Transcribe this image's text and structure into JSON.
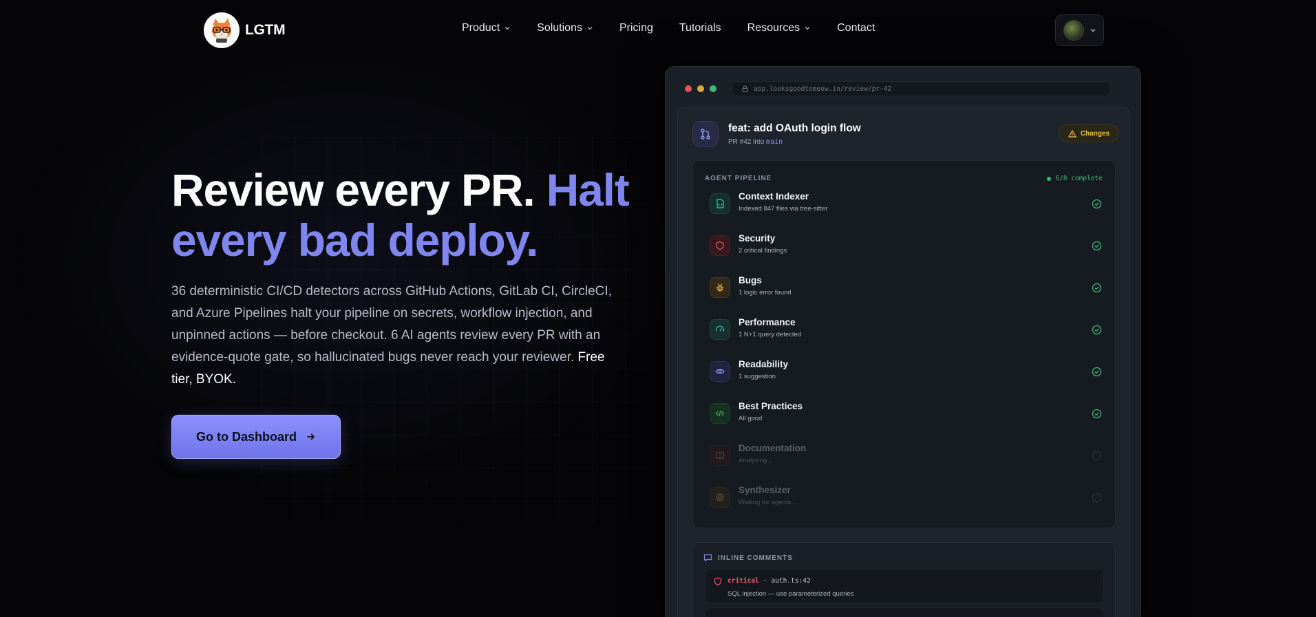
{
  "brand": {
    "name": "LGTM"
  },
  "nav": {
    "items": [
      {
        "label": "Product",
        "dropdown": true
      },
      {
        "label": "Solutions",
        "dropdown": true
      },
      {
        "label": "Pricing",
        "dropdown": false
      },
      {
        "label": "Tutorials",
        "dropdown": false
      },
      {
        "label": "Resources",
        "dropdown": true
      },
      {
        "label": "Contact",
        "dropdown": false
      }
    ]
  },
  "hero": {
    "title_part1": "Review every PR.",
    "title_accent": "Halt every bad deploy.",
    "description": "36 deterministic CI/CD detectors across GitHub Actions, GitLab CI, CircleCI, and Azure Pipelines halt your pipeline on secrets, workflow injection, and unpinned actions — before checkout. 6 AI agents review every PR with an evidence-quote gate, so hallucinated bugs never reach your reviewer.",
    "description_strong": "Free tier, BYOK.",
    "cta_label": "Go to Dashboard"
  },
  "mockup": {
    "url": "app.looksgoodtomeow.in/review/pr-42",
    "pr": {
      "title": "feat: add OAuth login flow",
      "subtitle": "PR #42 into",
      "branch": "main",
      "badge": "Changes"
    },
    "pipeline": {
      "label": "AGENT PIPELINE",
      "status": "6/8 complete",
      "agents": [
        {
          "name": "Context Indexer",
          "desc": "Indexed 847 files via tree-sitter",
          "icon": "file-code-icon",
          "done": true
        },
        {
          "name": "Security",
          "desc": "2 critical findings",
          "icon": "shield-icon",
          "done": true
        },
        {
          "name": "Bugs",
          "desc": "1 logic error found",
          "icon": "bug-icon",
          "done": true
        },
        {
          "name": "Performance",
          "desc": "1 N+1 query detected",
          "icon": "gauge-icon",
          "done": true
        },
        {
          "name": "Readability",
          "desc": "1 suggestion",
          "icon": "eye-icon",
          "done": true
        },
        {
          "name": "Best Practices",
          "desc": "All good",
          "icon": "code-icon",
          "done": true
        },
        {
          "name": "Documentation",
          "desc": "Analyzing...",
          "icon": "book-icon",
          "done": false
        },
        {
          "name": "Synthesizer",
          "desc": "Waiting for agents...",
          "icon": "brain-icon",
          "done": false
        }
      ]
    },
    "comments": {
      "label": "INLINE COMMENTS",
      "items": [
        {
          "severity": "critical",
          "location": "auth.ts:42",
          "text": "SQL injection — use parameterized queries"
        }
      ]
    }
  },
  "colors": {
    "accent": "#7f86ee",
    "success": "#3fb877",
    "critical": "#f05a6a",
    "warning": "#f0c24a"
  }
}
